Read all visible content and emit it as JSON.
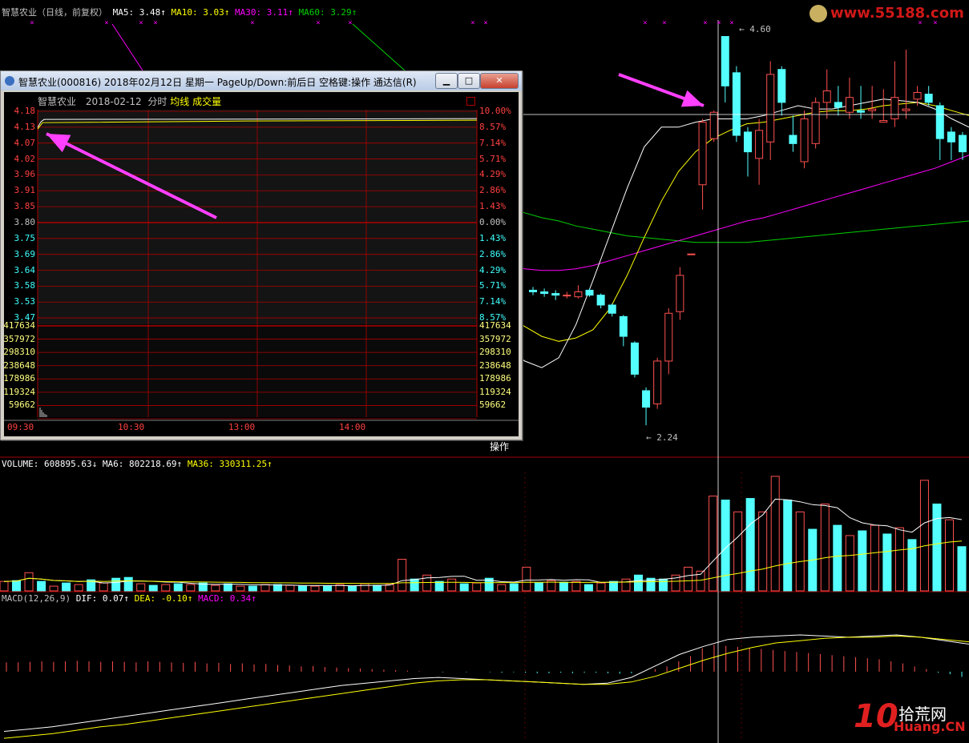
{
  "header": {
    "title": "智慧农业（日线，前复权）",
    "ma5": "MA5: 3.48↑",
    "ma10": "MA10: 3.03↑",
    "ma30": "MA30: 3.11↑",
    "ma60": "MA60: 3.29↑"
  },
  "colors": {
    "up": "#ff5050",
    "down": "#54ffff",
    "ma5": "#ffffff",
    "ma10": "#ffff00",
    "ma30": "#ff00ff",
    "ma60": "#00d000",
    "grid": "#b00000"
  },
  "annotations": {
    "high": "4.60",
    "low": "2.24"
  },
  "volume_header": {
    "volume": "VOLUME: 608895.63↓",
    "ma6": "MA6: 802218.69↑",
    "ma36": "MA36: 330311.25↑"
  },
  "macd_header": {
    "name": "MACD(12,26,9)",
    "dif": "DIF: 0.07↑",
    "dea": "DEA: -0.10↑",
    "macd": "MACD: 0.34↑"
  },
  "popup": {
    "window_title": "智慧农业(000816) 2018年02月12日 星期一 PageUp/Down:前后日 空格键:操作 通达信(R)",
    "stock_name": "智慧农业",
    "date": "2018-02-12",
    "mode": "分时",
    "avg_line": "均线",
    "volume_label": "成交量",
    "price_ticks": [
      "4.18",
      "4.13",
      "4.07",
      "4.02",
      "3.96",
      "3.91",
      "3.85",
      "3.80",
      "3.75",
      "3.69",
      "3.64",
      "3.58",
      "3.53",
      "3.47"
    ],
    "pct_ticks": [
      "10.00%",
      "8.57%",
      "7.14%",
      "5.71%",
      "4.29%",
      "2.86%",
      "1.43%",
      "0.00%",
      "1.43%",
      "2.86%",
      "4.29%",
      "5.71%",
      "7.14%",
      "8.57%"
    ],
    "vol_ticks": [
      "417634",
      "357972",
      "298310",
      "238648",
      "178986",
      "119324",
      "59662"
    ],
    "time_ticks": [
      "09:30",
      "10:30",
      "13:00",
      "14:00"
    ],
    "operate_button": "操作",
    "minimize_icon": "minimize-icon",
    "maximize_icon": "maximize-icon",
    "close_icon": "close-icon"
  },
  "watermarks": {
    "top": "www.55188.com",
    "bottom_main": "拾荒网",
    "bottom_sub": "Huang.CN",
    "bottom_num": "10"
  },
  "chart_data": {
    "type": "candlestick",
    "title": "智慧农业（日线，前复权）",
    "price_range": [
      2.1,
      4.7
    ],
    "candles": [
      {
        "o": 3.06,
        "c": 3.05,
        "h": 3.08,
        "l": 3.03
      },
      {
        "o": 3.05,
        "c": 3.04,
        "h": 3.07,
        "l": 3.02
      },
      {
        "o": 3.04,
        "c": 3.03,
        "h": 3.06,
        "l": 3.0
      },
      {
        "o": 3.03,
        "c": 3.03,
        "h": 3.05,
        "l": 3.01
      },
      {
        "o": 3.02,
        "c": 3.05,
        "h": 3.09,
        "l": 3.01
      },
      {
        "o": 3.06,
        "c": 3.03,
        "h": 3.07,
        "l": 3.02
      },
      {
        "o": 3.03,
        "c": 2.97,
        "h": 3.04,
        "l": 2.95
      },
      {
        "o": 2.97,
        "c": 2.92,
        "h": 2.98,
        "l": 2.9
      },
      {
        "o": 2.9,
        "c": 2.78,
        "h": 2.91,
        "l": 2.72
      },
      {
        "o": 2.74,
        "c": 2.55,
        "h": 2.75,
        "l": 2.53
      },
      {
        "o": 2.45,
        "c": 2.35,
        "h": 2.47,
        "l": 2.24
      },
      {
        "o": 2.37,
        "c": 2.63,
        "h": 2.65,
        "l": 2.34
      },
      {
        "o": 2.63,
        "c": 2.92,
        "h": 2.95,
        "l": 2.55
      },
      {
        "o": 2.93,
        "c": 3.15,
        "h": 3.2,
        "l": 2.88
      },
      {
        "o": 3.28,
        "c": 3.28,
        "h": 3.28,
        "l": 3.28
      },
      {
        "o": 3.7,
        "c": 4.08,
        "h": 4.1,
        "l": 3.55
      },
      {
        "o": 3.98,
        "c": 4.14,
        "h": 4.15,
        "l": 3.96
      },
      {
        "o": 4.6,
        "c": 4.3,
        "h": 4.6,
        "l": 4.2
      },
      {
        "o": 4.38,
        "c": 4.0,
        "h": 4.42,
        "l": 3.96
      },
      {
        "o": 4.02,
        "c": 3.9,
        "h": 4.05,
        "l": 3.75
      },
      {
        "o": 3.86,
        "c": 4.03,
        "h": 4.1,
        "l": 3.7
      },
      {
        "o": 3.96,
        "c": 4.37,
        "h": 4.45,
        "l": 3.85
      },
      {
        "o": 4.4,
        "c": 4.2,
        "h": 4.42,
        "l": 4.12
      },
      {
        "o": 4.0,
        "c": 3.95,
        "h": 4.12,
        "l": 3.9
      },
      {
        "o": 3.84,
        "c": 4.1,
        "h": 4.15,
        "l": 3.8
      },
      {
        "o": 3.95,
        "c": 4.2,
        "h": 4.23,
        "l": 3.92
      },
      {
        "o": 4.2,
        "c": 4.27,
        "h": 4.4,
        "l": 4.1
      },
      {
        "o": 4.2,
        "c": 4.17,
        "h": 4.3,
        "l": 4.12
      },
      {
        "o": 4.14,
        "c": 4.23,
        "h": 4.35,
        "l": 4.1
      },
      {
        "o": 4.15,
        "c": 4.14,
        "h": 4.3,
        "l": 4.1
      },
      {
        "o": 4.15,
        "c": 4.16,
        "h": 4.3,
        "l": 4.1
      },
      {
        "o": 4.08,
        "c": 4.09,
        "h": 4.28,
        "l": 4.08
      },
      {
        "o": 4.1,
        "c": 4.23,
        "h": 4.45,
        "l": 4.05
      },
      {
        "o": 4.15,
        "c": 4.16,
        "h": 4.52,
        "l": 4.1
      },
      {
        "o": 4.22,
        "c": 4.26,
        "h": 4.3,
        "l": 4.18
      },
      {
        "o": 4.25,
        "c": 4.2,
        "h": 4.3,
        "l": 4.18
      },
      {
        "o": 4.18,
        "c": 3.98,
        "h": 4.2,
        "l": 3.85
      },
      {
        "o": 4.02,
        "c": 3.96,
        "h": 4.05,
        "l": 3.85
      },
      {
        "o": 4.0,
        "c": 3.9,
        "h": 4.02,
        "l": 3.85
      }
    ],
    "ma5": [
      3.05,
      3.05,
      3.04,
      3.04,
      3.04,
      3.04,
      3.03,
      3.01,
      2.95,
      2.85,
      2.71,
      2.63,
      2.59,
      2.65,
      2.85,
      3.12,
      3.4,
      3.68,
      3.93,
      4.05,
      4.05,
      4.08,
      4.1,
      4.1,
      4.1,
      4.12,
      4.15,
      4.18,
      4.16,
      4.16,
      4.18,
      4.2,
      4.22,
      4.21,
      4.2,
      4.16,
      4.1,
      4.05
    ],
    "ma10": [
      3.08,
      3.07,
      3.06,
      3.05,
      3.05,
      3.05,
      3.04,
      3.02,
      3.0,
      2.96,
      2.9,
      2.84,
      2.78,
      2.75,
      2.77,
      2.82,
      2.95,
      3.15,
      3.38,
      3.6,
      3.78,
      3.9,
      3.98,
      4.03,
      4.07,
      4.08,
      4.1,
      4.12,
      4.14,
      4.15,
      4.15,
      4.16,
      4.18,
      4.19,
      4.2,
      4.18,
      4.15,
      4.12
    ],
    "ma30": [
      3.45,
      3.43,
      3.41,
      3.39,
      3.37,
      3.35,
      3.33,
      3.3,
      3.27,
      3.24,
      3.21,
      3.19,
      3.18,
      3.18,
      3.19,
      3.21,
      3.24,
      3.27,
      3.3,
      3.33,
      3.36,
      3.39,
      3.42,
      3.45,
      3.48,
      3.5,
      3.53,
      3.56,
      3.59,
      3.62,
      3.65,
      3.68,
      3.71,
      3.74,
      3.77,
      3.8,
      3.84,
      3.88
    ],
    "ma60": [
      3.96,
      3.92,
      3.87,
      3.83,
      3.79,
      3.75,
      3.71,
      3.67,
      3.63,
      3.59,
      3.56,
      3.53,
      3.5,
      3.48,
      3.45,
      3.43,
      3.41,
      3.39,
      3.38,
      3.37,
      3.36,
      3.35,
      3.35,
      3.35,
      3.35,
      3.36,
      3.37,
      3.38,
      3.39,
      3.4,
      3.41,
      3.42,
      3.43,
      3.44,
      3.45,
      3.46,
      3.47,
      3.48
    ],
    "volume": {
      "range": [
        0,
        1500000
      ],
      "bars": [
        [
          1,
          120000
        ],
        [
          0,
          130000
        ],
        [
          1,
          230000
        ],
        [
          0,
          120000
        ],
        [
          1,
          60000
        ],
        [
          0,
          100000
        ],
        [
          1,
          80000
        ],
        [
          0,
          140000
        ],
        [
          1,
          100000
        ],
        [
          0,
          160000
        ],
        [
          0,
          170000
        ],
        [
          1,
          90000
        ],
        [
          0,
          70000
        ],
        [
          1,
          80000
        ],
        [
          0,
          90000
        ],
        [
          1,
          80000
        ],
        [
          0,
          100000
        ],
        [
          1,
          70000
        ],
        [
          0,
          90000
        ],
        [
          1,
          60000
        ],
        [
          0,
          60000
        ],
        [
          1,
          80000
        ],
        [
          0,
          80000
        ],
        [
          1,
          70000
        ],
        [
          0,
          60000
        ],
        [
          1,
          60000
        ],
        [
          0,
          60000
        ],
        [
          1,
          80000
        ],
        [
          0,
          60000
        ],
        [
          1,
          90000
        ],
        [
          0,
          70000
        ],
        [
          1,
          80000
        ],
        [
          1,
          400000
        ],
        [
          0,
          150000
        ],
        [
          1,
          200000
        ],
        [
          0,
          120000
        ],
        [
          1,
          150000
        ],
        [
          0,
          90000
        ],
        [
          1,
          100000
        ],
        [
          0,
          160000
        ],
        [
          1,
          80000
        ],
        [
          0,
          90000
        ],
        [
          1,
          300000
        ],
        [
          0,
          100000
        ],
        [
          1,
          130000
        ],
        [
          0,
          110000
        ],
        [
          1,
          120000
        ],
        [
          0,
          80000
        ],
        [
          1,
          100000
        ],
        [
          0,
          120000
        ],
        [
          1,
          150000
        ],
        [
          0,
          200000
        ],
        [
          0,
          160000
        ],
        [
          0,
          150000
        ],
        [
          1,
          200000
        ],
        [
          1,
          300000
        ],
        [
          1,
          250000
        ],
        [
          1,
          1200000
        ],
        [
          0,
          1150000
        ],
        [
          1,
          1000000
        ],
        [
          0,
          1170000
        ],
        [
          1,
          1000000
        ],
        [
          1,
          1450000
        ],
        [
          0,
          1150000
        ],
        [
          1,
          1000000
        ],
        [
          0,
          780000
        ],
        [
          1,
          1100000
        ],
        [
          0,
          830000
        ],
        [
          1,
          700000
        ],
        [
          0,
          760000
        ],
        [
          1,
          830000
        ],
        [
          0,
          720000
        ],
        [
          1,
          800000
        ],
        [
          0,
          650000
        ],
        [
          1,
          1400000
        ],
        [
          0,
          1100000
        ],
        [
          1,
          900000
        ],
        [
          0,
          560000
        ]
      ]
    },
    "macd": {
      "range": [
        -0.6,
        0.55
      ],
      "hist": [
        0.18,
        0.18,
        0.19,
        0.2,
        0.19,
        0.2,
        0.21,
        0.2,
        0.19,
        0.2,
        0.19,
        0.18,
        0.2,
        0.19,
        0.18,
        0.17,
        0.19,
        0.16,
        0.17,
        0.15,
        0.16,
        0.14,
        0.15,
        0.13,
        0.12,
        0.1,
        0.11,
        0.09,
        0.08,
        0.07,
        0.06,
        0.05,
        0.04,
        0.03,
        0.02,
        0.01,
        0.0,
        -0.01,
        0.0,
        -0.01,
        0.0,
        -0.01,
        -0.02,
        -0.01,
        -0.02,
        -0.03,
        -0.03,
        -0.02,
        -0.03,
        -0.02,
        -0.02,
        -0.03,
        -0.04,
        -0.03,
        0.0,
        0.05,
        0.1,
        0.2,
        0.3,
        0.45,
        0.52,
        0.5,
        0.48,
        0.46,
        0.44,
        0.42,
        0.4,
        0.38,
        0.36,
        0.34,
        0.32,
        0.3,
        0.28,
        0.26,
        0.24,
        0.2,
        0.16,
        0.1,
        0.05,
        -0.02,
        -0.05,
        -0.1
      ],
      "dif": [
        -0.52,
        -0.5,
        -0.48,
        -0.45,
        -0.42,
        -0.39,
        -0.36,
        -0.33,
        -0.3,
        -0.27,
        -0.24,
        -0.21,
        -0.18,
        -0.15,
        -0.12,
        -0.1,
        -0.08,
        -0.06,
        -0.05,
        -0.06,
        -0.07,
        -0.08,
        -0.09,
        -0.1,
        -0.11,
        -0.1,
        -0.05,
        0.05,
        0.15,
        0.22,
        0.28,
        0.3,
        0.31,
        0.32,
        0.31,
        0.3,
        0.31,
        0.32,
        0.3,
        0.27,
        0.24
      ],
      "dea": [
        -0.58,
        -0.56,
        -0.54,
        -0.51,
        -0.48,
        -0.46,
        -0.43,
        -0.4,
        -0.37,
        -0.34,
        -0.31,
        -0.28,
        -0.25,
        -0.22,
        -0.19,
        -0.16,
        -0.13,
        -0.1,
        -0.08,
        -0.07,
        -0.07,
        -0.08,
        -0.09,
        -0.1,
        -0.11,
        -0.11,
        -0.09,
        -0.04,
        0.03,
        0.1,
        0.16,
        0.21,
        0.25,
        0.27,
        0.29,
        0.3,
        0.3,
        0.31,
        0.3,
        0.28,
        0.26
      ]
    },
    "intraday": {
      "price_range": [
        3.42,
        4.18
      ],
      "line_value": 4.15
    }
  }
}
